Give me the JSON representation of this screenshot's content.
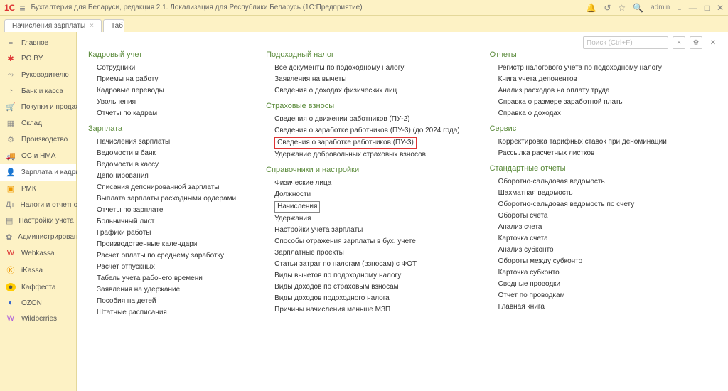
{
  "titlebar": {
    "logo": "1C",
    "title": "Бухгалтерия для Беларуси, редакция 2.1. Локализация для Республики Беларусь   (1С:Предприятие)",
    "user": "admin"
  },
  "tabs": [
    {
      "label": "Начисления зарплаты"
    },
    {
      "label": "Таб"
    }
  ],
  "search": {
    "placeholder": "Поиск (Ctrl+F)",
    "x": "×"
  },
  "sidebar": [
    {
      "icon": "≡",
      "label": "Главное",
      "cls": "ic-gray"
    },
    {
      "icon": "✱",
      "label": "PO.BY",
      "cls": "ic-red"
    },
    {
      "icon": "⤳",
      "label": "Руководителю",
      "cls": "ic-gray"
    },
    {
      "icon": "◔",
      "label": "Банк и касса",
      "cls": "ic-gray"
    },
    {
      "icon": "🛒",
      "label": "Покупки и продажи",
      "cls": "ic-gray"
    },
    {
      "icon": "▦",
      "label": "Склад",
      "cls": "ic-gray"
    },
    {
      "icon": "⚙",
      "label": "Производство",
      "cls": "ic-gray"
    },
    {
      "icon": "🚚",
      "label": "ОС и НМА",
      "cls": "ic-gray"
    },
    {
      "icon": "👤",
      "label": "Зарплата и кадры",
      "cls": "ic-gray",
      "active": true
    },
    {
      "icon": "▣",
      "label": "РМК",
      "cls": "ic-orange"
    },
    {
      "icon": "Дт",
      "label": "Налоги и отчетность",
      "cls": "ic-gray"
    },
    {
      "icon": "▤",
      "label": "Настройки учета",
      "cls": "ic-gray"
    },
    {
      "icon": "✿",
      "label": "Администрирование",
      "cls": "ic-gray"
    },
    {
      "icon": "W",
      "label": "Webkassa",
      "cls": "ic-red"
    },
    {
      "icon": "Ⓚ",
      "label": "iKassa",
      "cls": "ic-orange"
    },
    {
      "icon": "●",
      "label": "Каффеста",
      "cls": "ic-yellow"
    },
    {
      "icon": "◐",
      "label": "OZON",
      "cls": "ic-blue"
    },
    {
      "icon": "W",
      "label": "Wildberries",
      "cls": "ic-purple"
    }
  ],
  "columns": [
    {
      "groups": [
        {
          "title": "Кадровый учет",
          "items": [
            "Сотрудники",
            "Приемы на работу",
            "Кадровые переводы",
            "Увольнения",
            "Отчеты по кадрам"
          ]
        },
        {
          "title": "Зарплата",
          "items": [
            "Начисления зарплаты",
            "Ведомости в банк",
            "Ведомости в кассу",
            "Депонирования",
            "Списания депонированной зарплаты",
            "Выплата зарплаты расходными ордерами",
            "Отчеты по зарплате",
            "Больничный лист",
            "Графики работы",
            "Производственные календари",
            "Расчет оплаты по среднему заработку",
            "Расчет отпускных",
            "Табель учета рабочего времени",
            "Заявления на удержание",
            "Пособия на детей",
            "Штатные расписания"
          ]
        }
      ]
    },
    {
      "groups": [
        {
          "title": "Подоходный налог",
          "items": [
            "Все документы по подоходному налогу",
            "Заявления на вычеты",
            "Сведения о доходах физических лиц"
          ]
        },
        {
          "title": "Страховые взносы",
          "items": [
            "Сведения о движении работников (ПУ-2)",
            "Сведения о заработке работников (ПУ-3) (до 2024 года)",
            {
              "t": "Сведения о заработке работников (ПУ-3)",
              "hl": "red"
            },
            "Удержание добровольных страховых взносов"
          ]
        },
        {
          "title": "Справочники и настройки",
          "items": [
            "Физические лица",
            "Должности",
            {
              "t": "Начисления",
              "hl": "box"
            },
            "Удержания",
            "Настройки учета зарплаты",
            "Способы отражения зарплаты в бух. учете",
            "Зарплатные проекты",
            "Статьи затрат по налогам (взносам) с ФОТ",
            "Виды вычетов по подоходному налогу",
            "Виды доходов по страховым взносам",
            "Виды доходов подоходного налога",
            "Причины начисления меньше МЗП"
          ]
        }
      ]
    },
    {
      "groups": [
        {
          "title": "Отчеты",
          "items": [
            "Регистр налогового учета по подоходному налогу",
            "Книга учета депонентов",
            "Анализ расходов на оплату труда",
            "Справка о размере заработной платы",
            "Справка о доходах"
          ]
        },
        {
          "title": "Сервис",
          "items": [
            "Корректировка тарифных ставок при деноминации",
            "Рассылка расчетных листков"
          ]
        },
        {
          "title": "Стандартные отчеты",
          "items": [
            "Оборотно-сальдовая ведомость",
            "Шахматная ведомость",
            "Оборотно-сальдовая ведомость по счету",
            "Обороты счета",
            "Анализ счета",
            "Карточка счета",
            "Анализ субконто",
            "Обороты между субконто",
            "Карточка субконто",
            "Сводные проводки",
            "Отчет по проводкам",
            "Главная книга"
          ]
        }
      ]
    }
  ]
}
